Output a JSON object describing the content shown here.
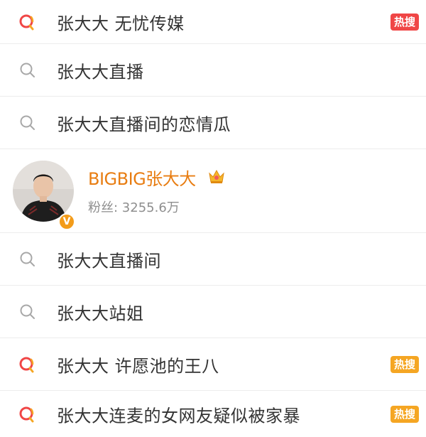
{
  "items": [
    {
      "text": "张大大 无忧传媒",
      "icon": "hot-search-icon",
      "badge": "热搜",
      "badge_color": "#f04646"
    },
    {
      "text": "张大大直播",
      "icon": "search-icon"
    },
    {
      "text": "张大大直播间的恋情瓜",
      "icon": "search-icon"
    },
    {
      "text": "张大大直播间",
      "icon": "search-icon"
    },
    {
      "text": "张大大站姐",
      "icon": "search-icon"
    },
    {
      "text": "张大大 许愿池的王八",
      "icon": "hot-search-icon",
      "badge": "热搜",
      "badge_color": "#f5a623"
    },
    {
      "text": "张大大连麦的女网友疑似被家暴",
      "icon": "hot-search-icon",
      "badge": "热搜",
      "badge_color": "#f5a623"
    }
  ],
  "user": {
    "name": "BIGBIG张大大",
    "fans": "粉丝: 3255.6万",
    "verified_mark": "V",
    "name_color": "#e87d12"
  },
  "colors": {
    "hot_icon_red": "#f04646",
    "hot_icon_orange": "#f5a623",
    "search_icon_gray": "#a8a8a8"
  }
}
